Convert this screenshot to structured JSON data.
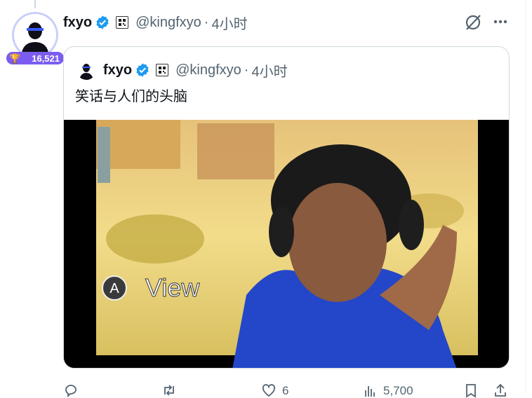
{
  "post": {
    "author": {
      "name": "fxyo",
      "handle": "@kingfxyo",
      "separator": "·",
      "time": "4小时",
      "badge_count": "16,521"
    },
    "quote": {
      "author": {
        "name": "fxyo",
        "handle": "@kingfxyo",
        "separator": "·",
        "time": "4小时"
      },
      "text": "笑话与人们的头脑",
      "video": {
        "overlay_button": "A",
        "overlay_label": "View"
      }
    },
    "actions": {
      "reply_count": "",
      "repost_count": "",
      "like_count": "6",
      "views_count": "5,700"
    }
  },
  "colors": {
    "verified": "#1d9bf0",
    "badge": "#7c5cf0",
    "secondary_text": "#536471",
    "border": "#cfd9de"
  },
  "icons": {
    "verified": "verified-badge-icon",
    "flag": "affiliate-flag-icon",
    "grok": "grok-icon",
    "more": "more-icon",
    "reply": "reply-icon",
    "repost": "repost-icon",
    "like": "like-icon",
    "views": "views-icon",
    "bookmark": "bookmark-icon",
    "share": "share-icon"
  }
}
